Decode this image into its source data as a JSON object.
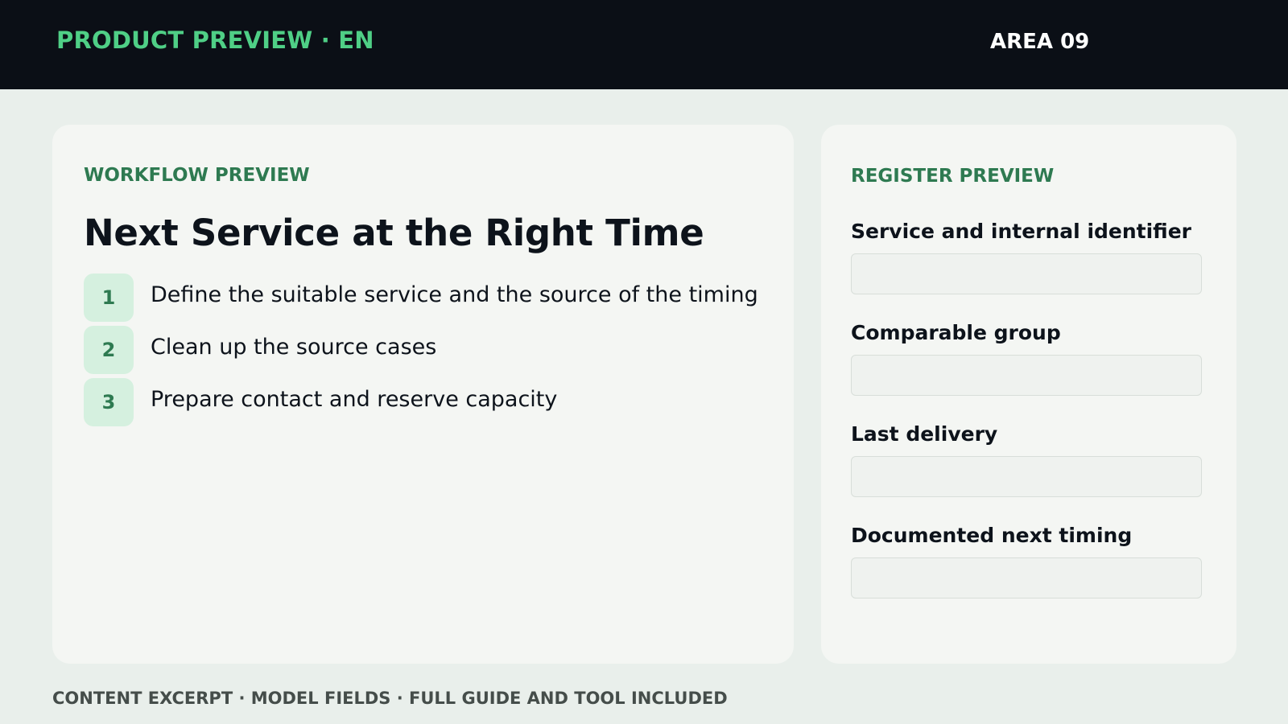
{
  "header": {
    "brand": "PRODUCT PREVIEW · EN",
    "area": "AREA 09"
  },
  "workflow": {
    "eyebrow": "WORKFLOW PREVIEW",
    "title": "Next Service at the Right Time",
    "steps": [
      {
        "number": "1",
        "text": "Define the suitable service and the source of the timing"
      },
      {
        "number": "2",
        "text": "Clean up the source cases"
      },
      {
        "number": "3",
        "text": "Prepare contact and reserve capacity"
      }
    ]
  },
  "register": {
    "eyebrow": "REGISTER PREVIEW",
    "fields": [
      {
        "label": "Service and internal identifier",
        "value": ""
      },
      {
        "label": "Comparable group",
        "value": ""
      },
      {
        "label": "Last delivery",
        "value": ""
      },
      {
        "label": "Documented next timing",
        "value": ""
      }
    ]
  },
  "footer": {
    "text": "CONTENT EXCERPT · MODEL FIELDS · FULL GUIDE AND TOOL INCLUDED"
  },
  "colors": {
    "topbar": "#0b0f16",
    "accent": "#4fcf86",
    "accent_dark": "#2e7a51",
    "background": "#e9efeb",
    "card": "#f4f6f3"
  }
}
